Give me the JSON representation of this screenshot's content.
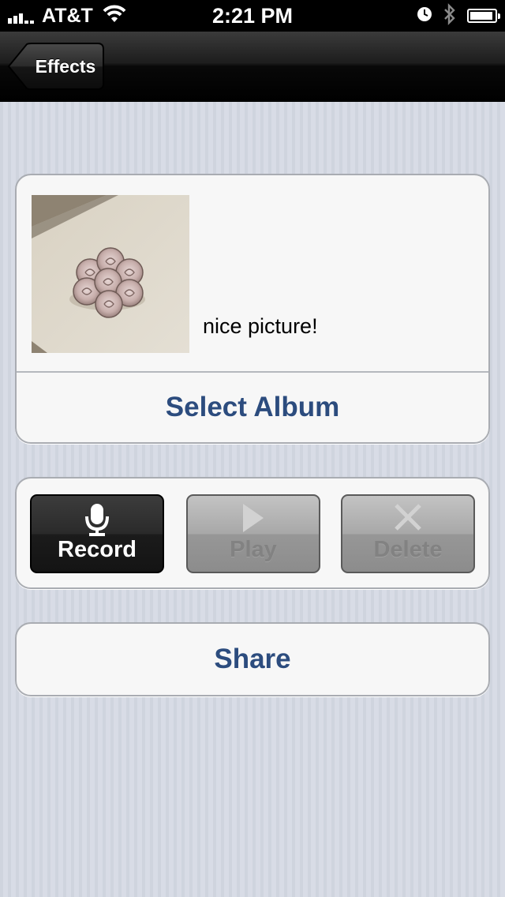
{
  "status_bar": {
    "carrier": "AT&T",
    "time": "2:21 PM",
    "signal_bars": 3,
    "battery_level": 0.85
  },
  "nav": {
    "back_label": "Effects"
  },
  "album": {
    "caption": "nice picture!",
    "select_album_label": "Select Album"
  },
  "recorder": {
    "record_label": "Record",
    "play_label": "Play",
    "delete_label": "Delete"
  },
  "share": {
    "label": "Share"
  },
  "colors": {
    "link_blue": "#2c4c7e",
    "background": "#d3d7e1"
  }
}
